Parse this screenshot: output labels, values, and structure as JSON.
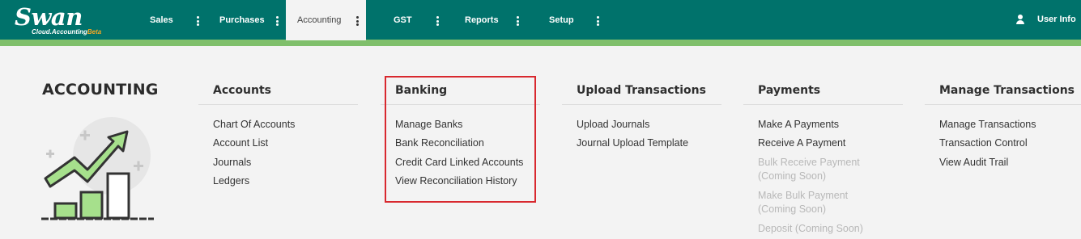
{
  "brand": {
    "name": "Swan",
    "tagline": "Cloud.Accounting",
    "beta": "Beta"
  },
  "nav": {
    "items": [
      {
        "label": "Sales"
      },
      {
        "label": "Purchases"
      },
      {
        "label": "Accounting"
      },
      {
        "label": "GST"
      },
      {
        "label": "Reports"
      },
      {
        "label": "Setup"
      }
    ],
    "active": "Accounting",
    "user_label": "User Info"
  },
  "page": {
    "title": "ACCOUNTING"
  },
  "menu": {
    "accounts": {
      "header": "Accounts",
      "links": [
        "Chart Of Accounts",
        "Account List",
        "Journals",
        "Ledgers"
      ]
    },
    "banking": {
      "header": "Banking",
      "links": [
        "Manage Banks",
        "Bank Reconciliation",
        "Credit Card Linked Accounts",
        "View Reconciliation History"
      ]
    },
    "upload": {
      "header": "Upload Transactions",
      "links": [
        "Upload Journals",
        "Journal Upload Template"
      ]
    },
    "payments": {
      "header": "Payments",
      "links": [
        "Make A Payments",
        "Receive A Payment"
      ],
      "disabled": [
        {
          "line1": "Bulk Receive Payment",
          "line2": "(Coming Soon)"
        },
        {
          "line1": "Make Bulk Payment",
          "line2": "(Coming Soon)"
        },
        {
          "line1": "Deposit (Coming Soon)"
        }
      ]
    },
    "manage": {
      "header": "Manage Transactions",
      "links": [
        "Manage Transactions",
        "Transaction Control",
        "View Audit Trail"
      ]
    }
  },
  "colors": {
    "topbar": "#00726b",
    "accent_line": "#7fbf6b",
    "highlight": "#d8282e",
    "chart_green": "#a6e08c"
  },
  "icons": [
    "kebab-menu-icon",
    "user-icon",
    "growth-chart-illustration"
  ]
}
